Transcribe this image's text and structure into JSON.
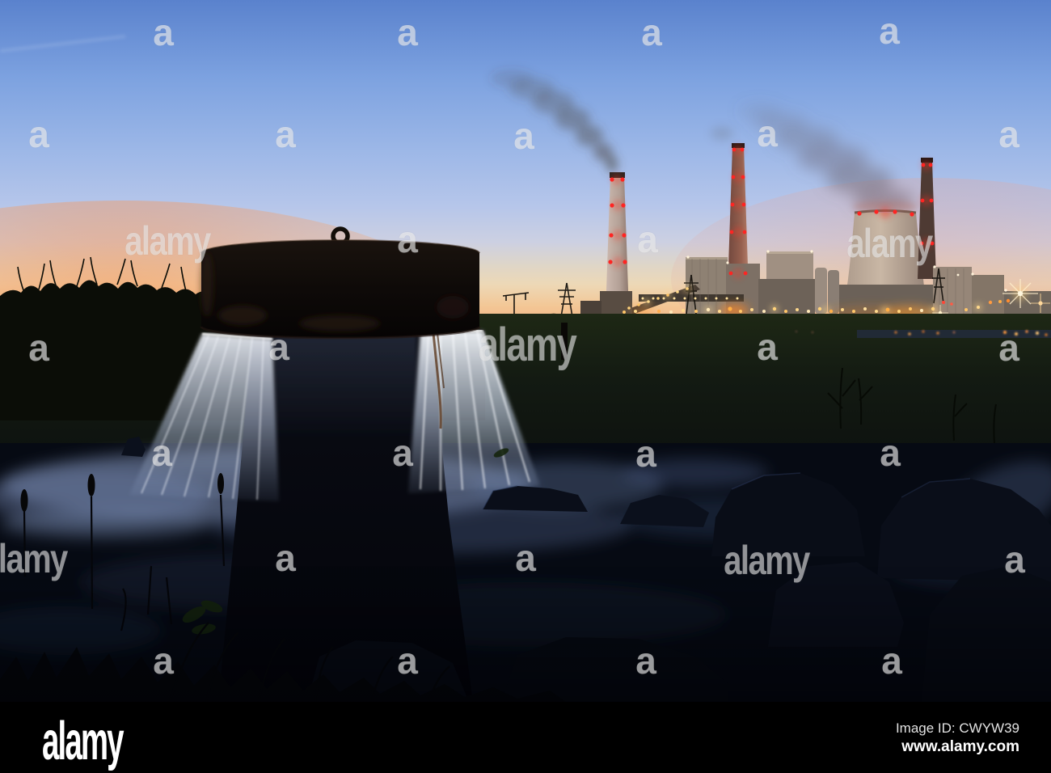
{
  "watermark": {
    "small_text": "a",
    "brand_text": "alamy"
  },
  "footer": {
    "logo_text": "alamy",
    "image_id_label": "Image ID: CWYW39",
    "website_url": "www.alamy.com"
  },
  "scene": {
    "colors": {
      "sky_top": "#5a82cd",
      "sky_mid_blue": "#9cb7e7",
      "sky_cream": "#edd8b6",
      "sunset_orange": "#f2a374",
      "deep_orange_horizon": "#ee9a6c",
      "aviation_light_red": "#ff2422",
      "plant_light_warm": "#ffc668",
      "plant_glow_orange": "#ff8a24",
      "steam_gray": "#6f6876",
      "smoke_gray": "#4a443e",
      "cooling_tower_tan": "#c9b7a5",
      "chimney_pale": "#cdbab0",
      "chimney_red_brown": "#b5816d",
      "mist_blue": "#8194ba",
      "cascade_white": "#f4f7fc",
      "well_cap_dark": "#120d09",
      "rust_brown": "#5c3a20",
      "rock_navy": "#0a0e19",
      "grass_black": "#0b0d07",
      "footer_bg": "#000000"
    }
  }
}
